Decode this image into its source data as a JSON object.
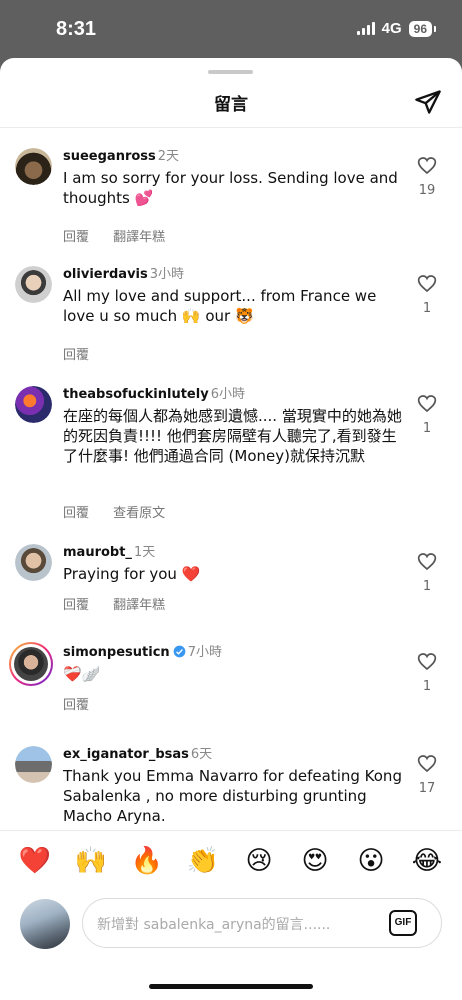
{
  "status": {
    "time": "8:31",
    "network": "4G",
    "battery": "96"
  },
  "header": {
    "title": "留言"
  },
  "comments": [
    {
      "username": "sueeganross",
      "time": "2天",
      "text": "I am so sorry for your loss. Sending love and thoughts 💕",
      "actions": [
        "回覆",
        "翻譯年糕"
      ],
      "likes": "19"
    },
    {
      "username": "olivierdavis",
      "time": "3小時",
      "text": "All my love and support... from France we love u so much 🙌 our 🐯",
      "actions": [
        "回覆"
      ],
      "likes": "1"
    },
    {
      "username": "theabsofuckinlutely",
      "time": "6小時",
      "text": "在座的每個人都為她感到遺憾.... 當現實中的她為她的死因負責!!!! 他們套房隔壁有人聽完了,看到發生了什麼事! 他們通過合同 (Money)就保持沉默",
      "actions": [
        "回覆",
        "查看原文"
      ],
      "likes": "1"
    },
    {
      "username": "maurobt_",
      "time": "1天",
      "text": "Praying for you ❤️",
      "actions": [
        "回覆",
        "翻譯年糕"
      ],
      "likes": "1"
    },
    {
      "username": "simonpesuticn",
      "time": "7小時",
      "text": "❤️‍🩹🪽",
      "actions": [
        "回覆"
      ],
      "likes": "1"
    },
    {
      "username": "ex_iganator_bsas",
      "time": "6天",
      "text": "Thank you Emma Navarro for defeating Kong Sabalenka , no more disturbing grunting Macho Aryna.",
      "actions": [],
      "likes": "17"
    }
  ],
  "reactions": [
    "❤️",
    "🙌",
    "🔥",
    "👏",
    "😢",
    "😍",
    "😮",
    "😂"
  ],
  "composer": {
    "placeholder": "新增對 sabalenka_aryna的留言......",
    "gif_label": "GIF"
  }
}
